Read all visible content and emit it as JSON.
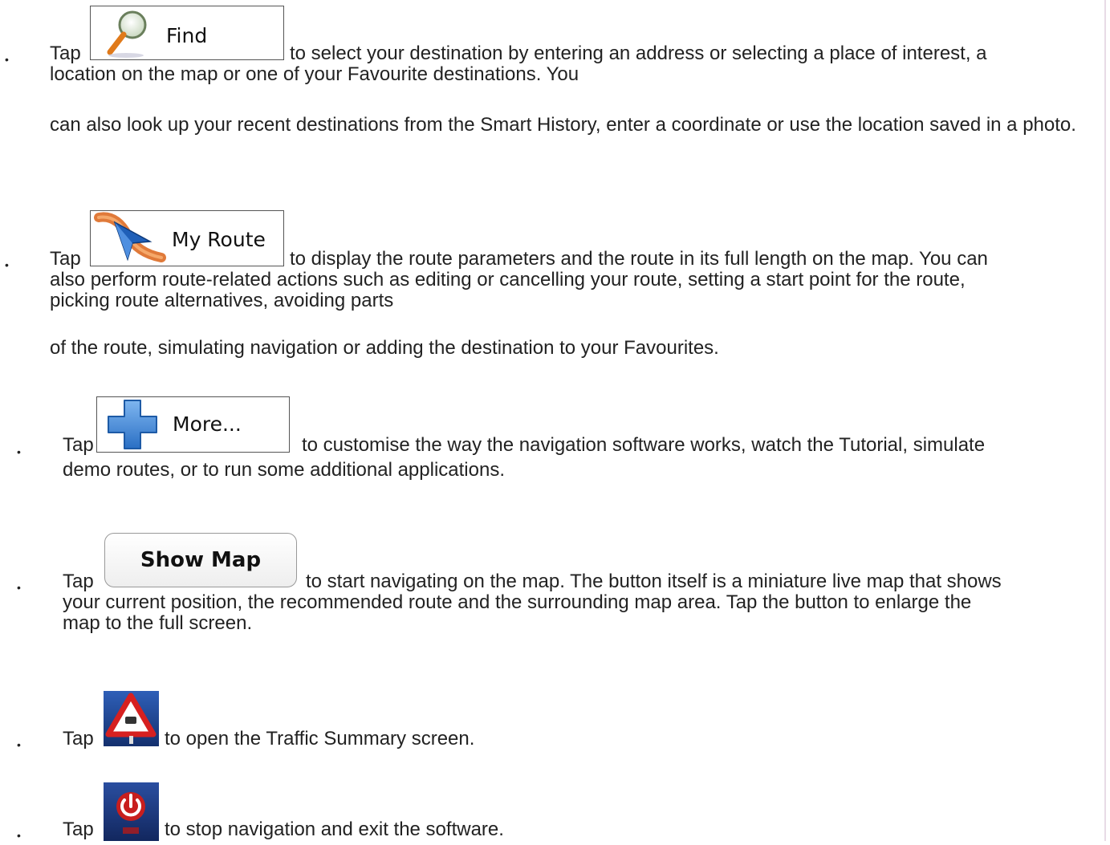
{
  "items": [
    {
      "bullet": "•",
      "tap": "Tap",
      "button_label": "Find",
      "button_icon": "magnifier-icon",
      "line1": "to select your destination by entering an address or selecting a place of interest, a",
      "line2": "location on the map or one of your Favourite destinations. You",
      "para2": "can also look up your recent destinations from the Smart History, enter a coordinate or use the location saved in a photo."
    },
    {
      "bullet": "•",
      "tap": "Tap",
      "button_label": "My Route",
      "button_icon": "route-arrow-icon",
      "line1": "to display the route parameters and the route in its full length on the map. You can",
      "line2": "also perform route-related actions such as editing or cancelling your route, setting a start point for the route,",
      "line3": "picking route alternatives, avoiding parts",
      "para2": "of the route, simulating navigation or adding the destination to your Favourites."
    },
    {
      "bullet": "•",
      "tap": "Tap",
      "button_label": "More...",
      "button_icon": "plus-icon",
      "line1": "to customise the way the navigation software works, watch the Tutorial, simulate",
      "line2": "demo routes, or to run some additional applications."
    },
    {
      "bullet": "•",
      "tap": "Tap",
      "button_label": "Show Map",
      "line1": "to start navigating on the map. The button itself is a miniature live map that shows",
      "line2": "your current position, the recommended route and the surrounding map area. Tap the button to enlarge the",
      "line3": "map to the full screen."
    },
    {
      "bullet": "•",
      "tap": "Tap",
      "button_icon": "traffic-warning-icon",
      "line1": "to open the Traffic Summary screen."
    },
    {
      "bullet": "•",
      "tap": "Tap",
      "button_icon": "power-icon",
      "line1": "to stop navigation and exit the software."
    }
  ],
  "colors": {
    "text": "#222222",
    "plus_blue": "#3a86d6",
    "route_orange": "#e07a3a",
    "route_blue": "#1f5fb8",
    "traffic_red": "#d62020",
    "tile_blue": "#1c3c8c",
    "power_red": "#d42a2a"
  }
}
